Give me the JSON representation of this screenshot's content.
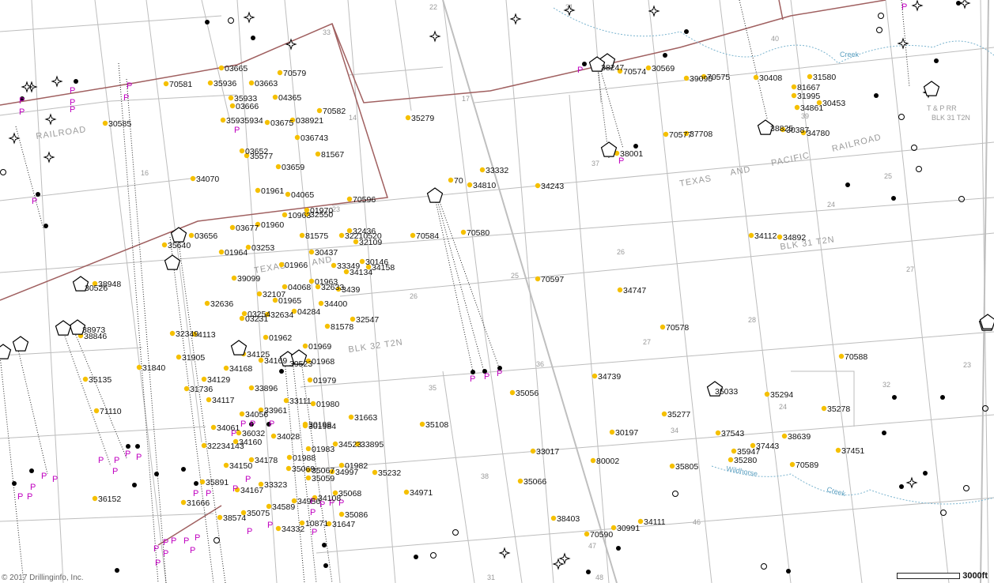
{
  "map": {
    "copyright": "© 2017 Drillinginfo, Inc.",
    "scale_label": "3000ft",
    "region_labels": {
      "railroad_left": "RAILROAD",
      "railroad_right": "RAILROAD",
      "texas": "TEXAS",
      "and": "AND",
      "pacific": "PACIFIC",
      "texas_left": "TEXAS",
      "and_left": "AND",
      "blk31": "BLK 31 T2N",
      "blk32": "BLK 32 T2N",
      "tp_rr": "T & P RR",
      "blk31_small": "BLK 31 T2N",
      "creek": "Creek",
      "wildhorse": "Wildhorse",
      "creek2": "Creek"
    },
    "sections": [
      "22",
      "33",
      "14",
      "16",
      "23",
      "26",
      "25",
      "24",
      "27",
      "28",
      "35",
      "36",
      "37",
      "39",
      "40",
      "32",
      "34",
      "38",
      "46",
      "47",
      "48",
      "17",
      "25",
      "26",
      "27",
      "23",
      "24",
      "31",
      "31",
      "32",
      "33",
      "34",
      "35",
      "36",
      "37",
      "38",
      "48",
      "47"
    ],
    "wells": [
      "03665",
      "70579",
      "70581",
      "35936",
      "03663",
      "35933",
      "04365",
      "03666",
      "70582",
      "35935934",
      "03675",
      "038921",
      "35279",
      "036743",
      "30585",
      "03652",
      "35577",
      "81567",
      "03659",
      "34070",
      "01961",
      "04065",
      "70596",
      "10963",
      "32550",
      "01970",
      "70584",
      "70580",
      "03677",
      "01960",
      "32436",
      "32210520",
      "35640",
      "03656",
      "01964",
      "03253",
      "81575",
      "32109",
      "30437",
      "30146",
      "01966",
      "33349",
      "34158",
      "34134",
      "39099",
      "01963",
      "04068",
      "32633",
      "3439",
      "30526",
      "38948",
      "32107",
      "01965",
      "34400",
      "32636",
      "04284",
      "03254",
      "32634",
      "32547",
      "03231",
      "81578",
      "32349",
      "4113",
      "38973",
      "38846",
      "01962",
      "01969",
      "31905",
      "34125",
      "34169",
      "39523",
      "01968",
      "31840",
      "34168",
      "34129",
      "01979",
      "35135",
      "31736",
      "33896",
      "33111",
      "01980",
      "34117",
      "33961",
      "31663",
      "71110",
      "34056",
      "35108",
      "30198",
      "301984",
      "34061",
      "36032",
      "34028",
      "32234143",
      "34160",
      "34523",
      "33895",
      "01983",
      "01988",
      "34178",
      "35069",
      "35067",
      "01982",
      "34150",
      "35232",
      "35059",
      "34997",
      "35891",
      "33323",
      "34167",
      "36152",
      "35068",
      "31666",
      "34956",
      "34589",
      "34971",
      "34108",
      "35075",
      "35086",
      "38574",
      "10871",
      "31647",
      "34332",
      "38247",
      "70574",
      "30569",
      "39095",
      "70575",
      "30408",
      "31580",
      "81667",
      "31995",
      "30453",
      "34861",
      "70577",
      "37708",
      "38825",
      "30387",
      "34780",
      "33332",
      "70",
      "34810",
      "34243",
      "38001",
      "34112",
      "34892",
      "70597",
      "34747",
      "70578",
      "70588",
      "34739",
      "35056",
      "35033",
      "35294",
      "35278",
      "35277",
      "30197",
      "37543",
      "38639",
      "33017",
      "37443",
      "35947",
      "37451",
      "80002",
      "35805",
      "35280",
      "70589",
      "35066",
      "38403",
      "34111",
      "30991",
      "70590"
    ]
  }
}
